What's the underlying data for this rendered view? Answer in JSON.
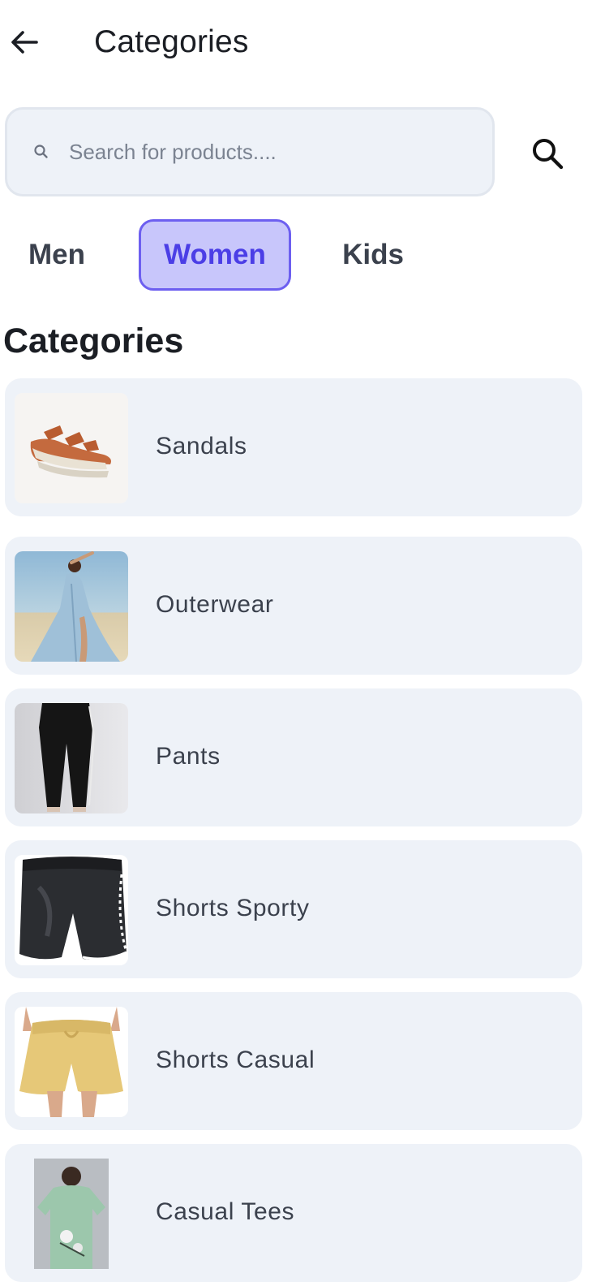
{
  "header": {
    "title": "Categories",
    "back_icon": "arrow-left-icon"
  },
  "search": {
    "placeholder": "Search for products....",
    "value": "",
    "icon": "search-icon",
    "button_icon": "search-icon"
  },
  "tabs": [
    {
      "label": "Men",
      "selected": false
    },
    {
      "label": "Women",
      "selected": true
    },
    {
      "label": "Kids",
      "selected": false
    }
  ],
  "section_title": "Categories",
  "categories": [
    {
      "label": "Sandals",
      "thumb": "sandal-image"
    },
    {
      "label": "Outerwear",
      "thumb": "beach-dress-image"
    },
    {
      "label": "Pants",
      "thumb": "black-pants-image"
    },
    {
      "label": "Shorts Sporty",
      "thumb": "black-sport-shorts-image"
    },
    {
      "label": "Shorts Casual",
      "thumb": "yellow-casual-shorts-image"
    },
    {
      "label": "Casual Tees",
      "thumb": "green-tee-image"
    }
  ],
  "colors": {
    "accent": "#6d5ff0",
    "accent_fill": "#c8c6fb",
    "card_bg": "#eef2f8",
    "text_primary": "#1b1e24",
    "text_secondary": "#3b414d"
  }
}
